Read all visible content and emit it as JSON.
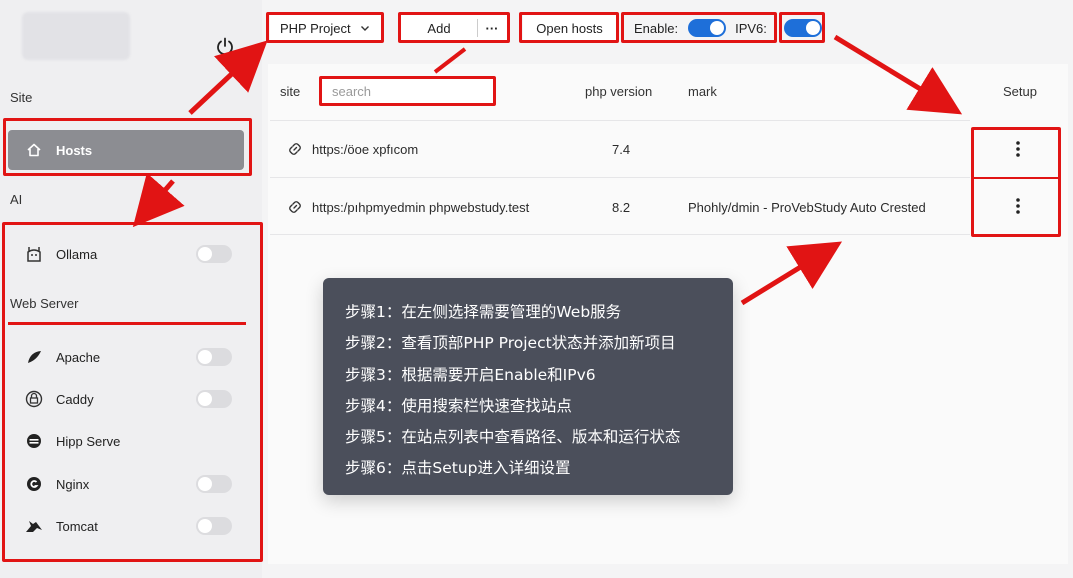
{
  "sidebar": {
    "section_site": "Site",
    "hosts_label": "Hosts",
    "section_ai": "AI",
    "section_web_server": "Web Server",
    "ai_items": [
      {
        "label": "Ollama",
        "icon": "llama-icon",
        "enabled": false
      }
    ],
    "web_items": [
      {
        "label": "Apache",
        "icon": "feather-icon",
        "enabled": false,
        "has_toggle": true
      },
      {
        "label": "Caddy",
        "icon": "lock-icon",
        "enabled": false,
        "has_toggle": true
      },
      {
        "label": "Hipp Serve",
        "icon": "server-icon",
        "has_toggle": false
      },
      {
        "label": "Nginx",
        "icon": "nginx-icon",
        "enabled": false,
        "has_toggle": true
      },
      {
        "label": "Tomcat",
        "icon": "cat-icon",
        "enabled": false,
        "has_toggle": true
      }
    ]
  },
  "toolbar": {
    "project_select": "PHP Project",
    "add_label": "Add",
    "more_label": "···",
    "open_hosts_label": "Open hosts",
    "enable_label": "Enable:",
    "enable_on": true,
    "ipv6_label": "IPV6:",
    "ipv6_on": true
  },
  "table": {
    "headers": {
      "site": "site",
      "php_version": "php version",
      "mark": "mark",
      "setup": "Setup"
    },
    "search_placeholder": "search",
    "rows": [
      {
        "site": "https:/öoe xpfıcom",
        "php": "7.4",
        "mark": ""
      },
      {
        "site": "https:/pıhpmyedmin phpwebstudy.test",
        "php": "8.2",
        "mark": "Phohly/dmin - ProVebStudy Auto Crested"
      }
    ]
  },
  "tooltip": {
    "steps": [
      "步骤1：在左侧选择需要管理的Web服务",
      "步骤2：查看顶部PHP Project状态并添加新项目",
      "步骤3：根据需要开启Enable和IPv6",
      "步骤4：使用搜索栏快速查找站点",
      "步骤5：在站点列表中查看路径、版本和运行状态",
      "步骤6：点击Setup进入详细设置"
    ]
  },
  "colors": {
    "annotation_red": "#e11414",
    "toggle_on_blue": "#1e6fd9",
    "hosts_active_bg": "#8c8d92",
    "tooltip_bg": "#4b4f5b"
  }
}
